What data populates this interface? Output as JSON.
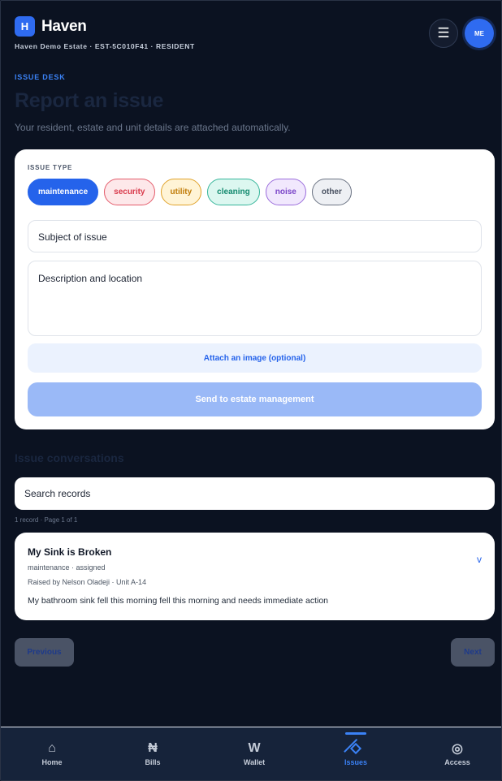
{
  "header": {
    "logo_letter": "H",
    "app_name": "Haven",
    "estate_line": "Haven Demo Estate · EST-5C010F41 · RESIDENT",
    "menu_glyph": "☰",
    "avatar_initials": "ME"
  },
  "page": {
    "eyebrow": "ISSUE DESK",
    "title": "Report an issue",
    "subtitle": "Your resident, estate and unit details are attached automatically."
  },
  "form": {
    "issue_type_label": "ISSUE TYPE",
    "issue_types": [
      "maintenance",
      "security",
      "utility",
      "cleaning",
      "noise",
      "other"
    ],
    "selected_type": "maintenance",
    "subject_placeholder": "Subject of issue",
    "description_placeholder": "Description and location",
    "attach_label": "Attach an image (optional)",
    "send_label": "Send to estate management"
  },
  "conversations": {
    "section_title": "Issue conversations",
    "search_placeholder": "Search records",
    "record_count": "1 record · Page 1 of 1",
    "items": [
      {
        "title": "My Sink is Broken",
        "meta": "maintenance · assigned",
        "raised": "Raised by Nelson Oladeji · Unit A-14",
        "description": "My bathroom sink fell this morning fell this morning and needs immediate action",
        "chevron": "v"
      }
    ],
    "previous_label": "Previous",
    "next_label": "Next"
  },
  "nav": {
    "items": [
      {
        "label": "Home",
        "glyph": "⌂",
        "icon": "home-icon"
      },
      {
        "label": "Bills",
        "glyph": "₦",
        "icon": "naira-icon"
      },
      {
        "label": "Wallet",
        "glyph": "W",
        "icon": "wallet-icon"
      },
      {
        "label": "Issues",
        "glyph": "",
        "icon": "issues-icon"
      },
      {
        "label": "Access",
        "glyph": "◎",
        "icon": "access-icon"
      }
    ],
    "active": "Issues"
  },
  "colors": {
    "background": "#0b1221",
    "accent": "#2563eb",
    "card": "#ffffff"
  }
}
